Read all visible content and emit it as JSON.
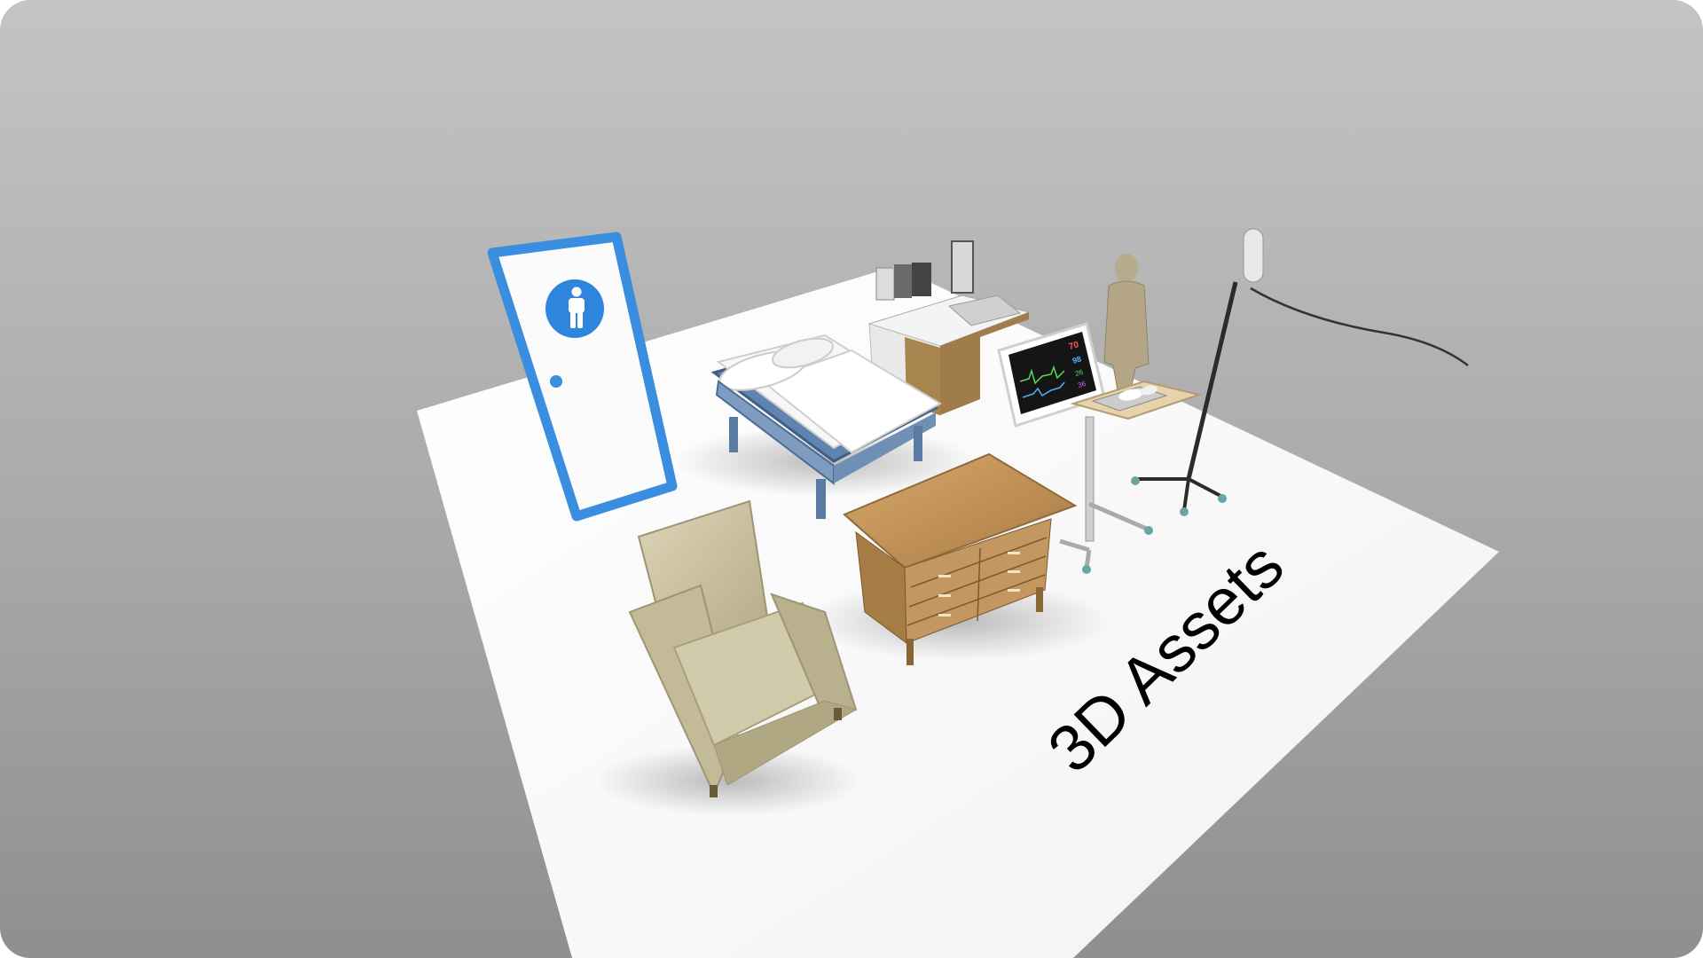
{
  "title": "3D Assets",
  "monitor": {
    "heart_rate": "70",
    "spo2": "98",
    "resp": "26",
    "temp": "36"
  },
  "colors": {
    "background_top": "#c4c4c4",
    "background_bottom": "#8f8f8f",
    "floor": "#ffffff",
    "door_frame": "#3a8ee0",
    "bed_rail": "#5f84b0",
    "wood": "#b98f5a",
    "armchair": "#cfc6a6"
  },
  "assets": [
    {
      "name": "restroom-door",
      "icon": "person-icon"
    },
    {
      "name": "hospital-bed"
    },
    {
      "name": "sink-counter"
    },
    {
      "name": "patient-monitor"
    },
    {
      "name": "mannequin"
    },
    {
      "name": "overbed-table"
    },
    {
      "name": "iv-pole"
    },
    {
      "name": "dresser"
    },
    {
      "name": "armchair"
    }
  ]
}
